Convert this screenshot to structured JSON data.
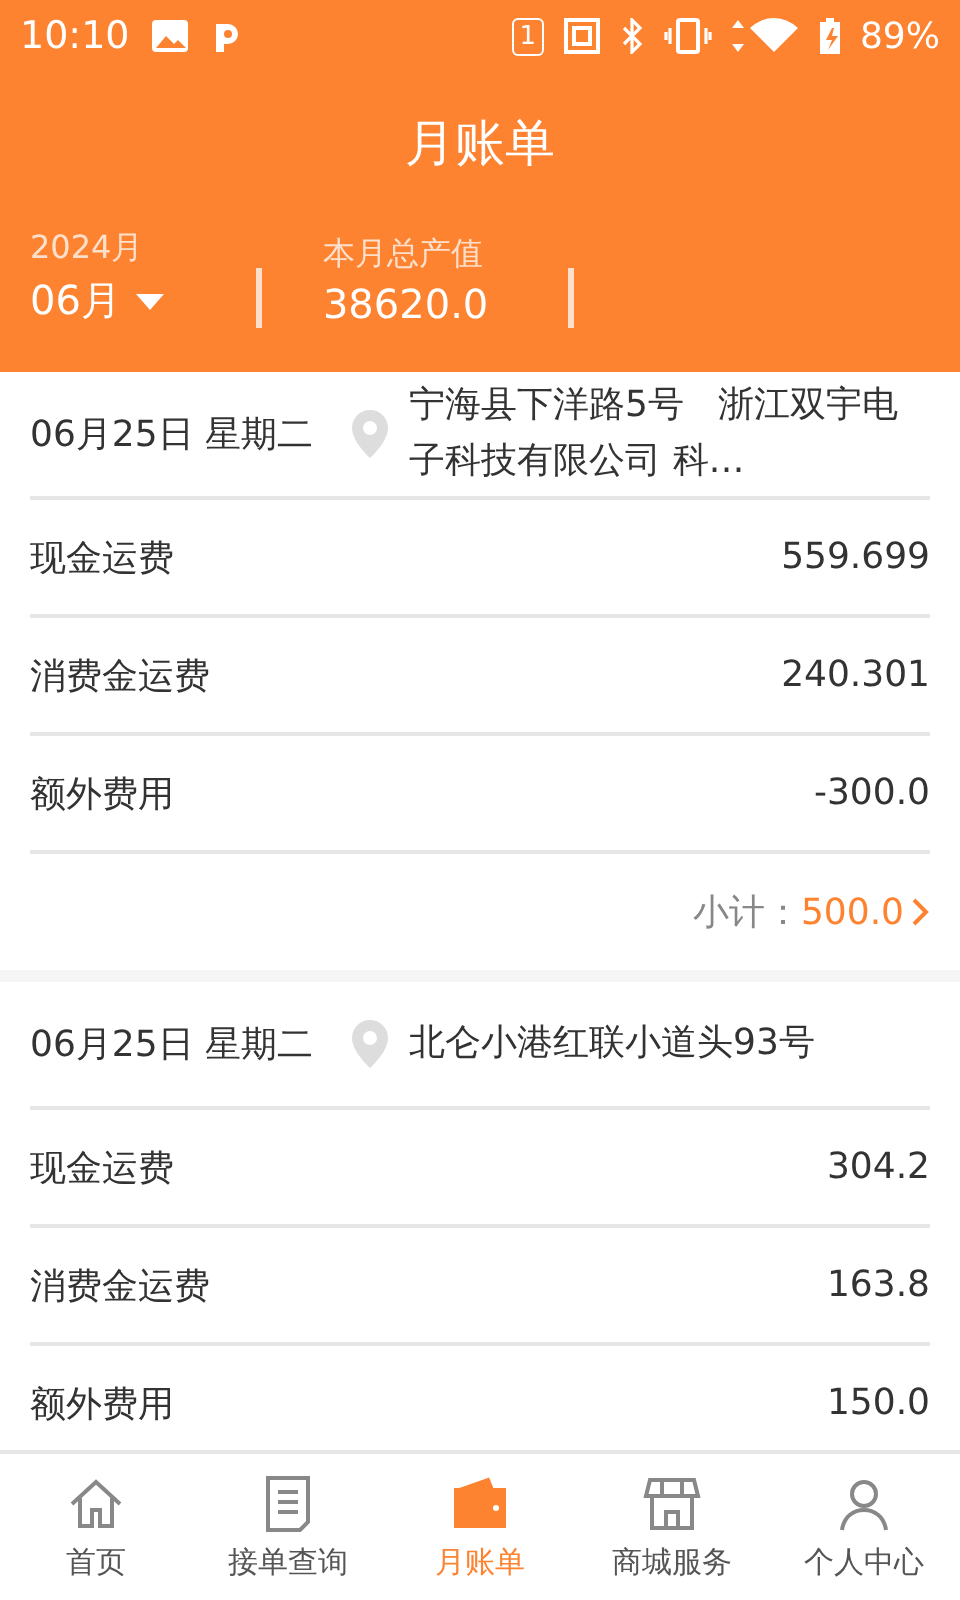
{
  "status_bar": {
    "time": "10:10",
    "sim": "1",
    "battery": "89%"
  },
  "title": "月账单",
  "summary": {
    "year": "2024月",
    "month": "06月",
    "total_label": "本月总产值",
    "total": "38620.0"
  },
  "bills": [
    {
      "date": "06月25日 星期二",
      "address": "宁海县下洋路5号   浙江双宇电子科技有限公司 科…",
      "rows": [
        {
          "label": "现金运费",
          "value": "559.699"
        },
        {
          "label": "消费金运费",
          "value": "240.301"
        },
        {
          "label": "额外费用",
          "value": "-300.0"
        }
      ],
      "subtotal_label": "小计：",
      "subtotal": "500.0"
    },
    {
      "date": "06月25日 星期二",
      "address": "北仑小港红联小道头93号",
      "rows": [
        {
          "label": "现金运费",
          "value": "304.2"
        },
        {
          "label": "消费金运费",
          "value": "163.8"
        },
        {
          "label": "额外费用",
          "value": "150.0"
        }
      ]
    }
  ],
  "tabs": [
    {
      "kind": "home",
      "label": "首页",
      "selected": false
    },
    {
      "kind": "orders",
      "label": "接单查询",
      "selected": false
    },
    {
      "kind": "wallet",
      "label": "月账单",
      "selected": true
    },
    {
      "kind": "shop",
      "label": "商城服务",
      "selected": false
    },
    {
      "kind": "person",
      "label": "个人中心",
      "selected": false
    }
  ]
}
